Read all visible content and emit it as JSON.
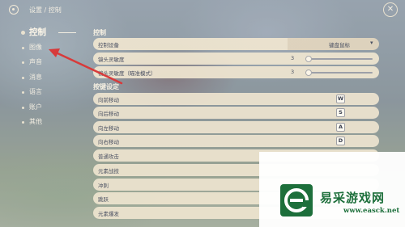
{
  "topbar": {
    "breadcrumb": "设置 / 控制",
    "close_glyph": "✕"
  },
  "sidebar": {
    "items": [
      {
        "label": "控制",
        "active": true
      },
      {
        "label": "图像",
        "active": false
      },
      {
        "label": "声音",
        "active": false
      },
      {
        "label": "消息",
        "active": false
      },
      {
        "label": "语言",
        "active": false
      },
      {
        "label": "账户",
        "active": false
      },
      {
        "label": "其他",
        "active": false
      }
    ]
  },
  "control": {
    "title": "控制",
    "control_device": {
      "label": "控制设备",
      "value": "键盘鼠标"
    },
    "camera_sensitivity": {
      "label": "镜头灵敏度",
      "value": "3"
    },
    "camera_sensitivity_aim": {
      "label": "镜头灵敏度（瞄准模式）",
      "value": "3"
    }
  },
  "keys": {
    "title": "按键设定",
    "rows": [
      {
        "label": "向前移动",
        "key": "W"
      },
      {
        "label": "向后移动",
        "key": "S"
      },
      {
        "label": "向左移动",
        "key": "A"
      },
      {
        "label": "向右移动",
        "key": "D"
      },
      {
        "label": "普通攻击",
        "key": ""
      },
      {
        "label": "元素战技",
        "key": ""
      },
      {
        "label": "冲刺",
        "key": ""
      },
      {
        "label": "跳跃",
        "key": ""
      },
      {
        "label": "元素爆发",
        "key": ""
      }
    ]
  },
  "watermark": {
    "name": "易采游戏网",
    "url": "www.easck.net",
    "color": "#1d6f3b"
  },
  "colors": {
    "row_bg": "#f0e6d0",
    "text_light": "#f3eee2",
    "text_dark": "#4a5062",
    "annotation_arrow": "#d83a3a"
  }
}
